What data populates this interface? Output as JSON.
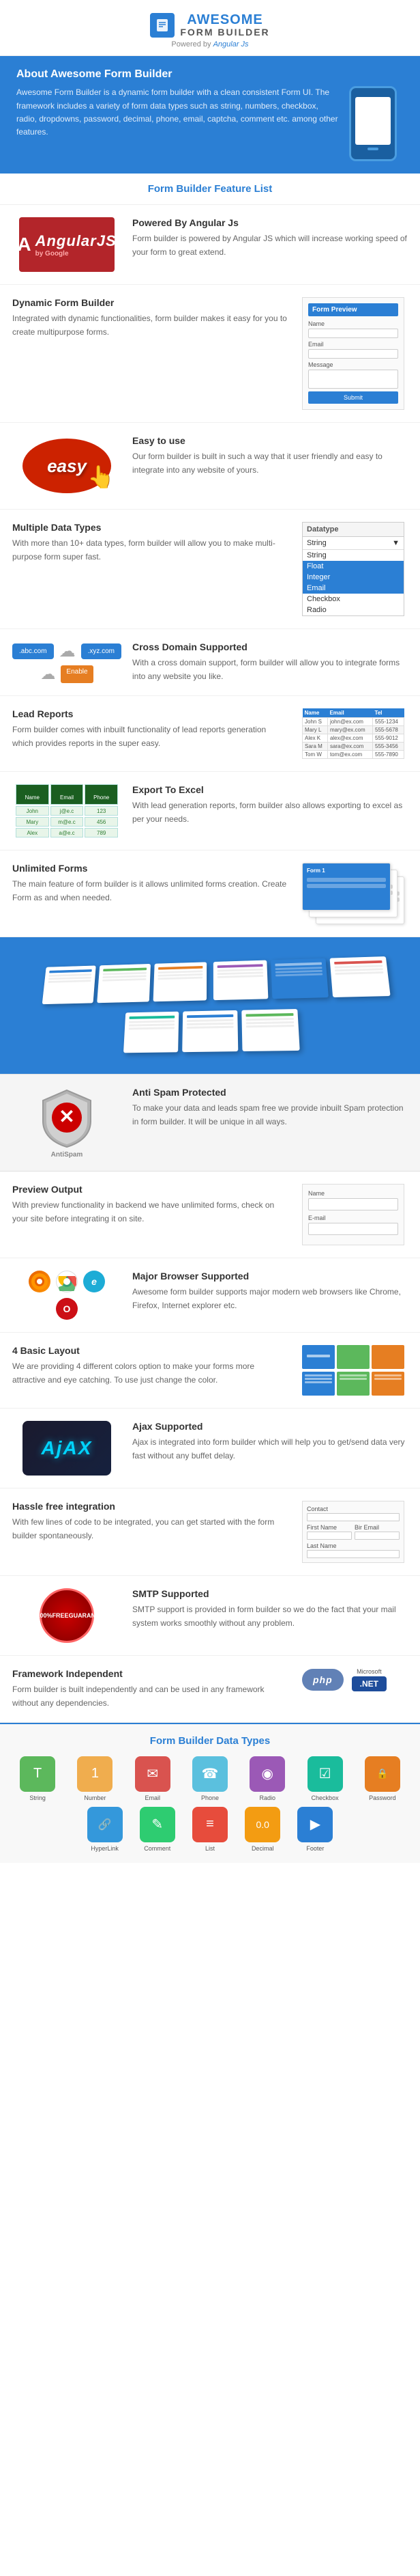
{
  "header": {
    "logo_icon": "📋",
    "logo_awesome": "AWESOME",
    "logo_formbuilder": "FORM BUILDER",
    "powered_by": "Powered by Angular Js"
  },
  "about": {
    "title": "About Awesome Form Builder",
    "description": "Awesome Form Builder is a dynamic form builder with a clean consistent Form UI. The framework includes a variety of form data types such as string, numbers, checkbox, radio, dropdowns, password, decimal, phone, email, captcha, comment etc. among other features."
  },
  "feature_list_title": "Form Builder Feature List",
  "features": [
    {
      "id": "angular",
      "title": "Powered By Angular Js",
      "description": "Form builder is powered by Angular JS which will increase working speed of your form to great extend.",
      "position": "left"
    },
    {
      "id": "dynamic",
      "title": "Dynamic Form Builder",
      "description": "Integrated with dynamic functionalities, form builder makes it easy for you to create multipurpose forms.",
      "position": "right"
    },
    {
      "id": "easy",
      "title": "Easy to use",
      "description": "Our form builder is built in such a way that it user friendly and easy to integrate into any website of yours.",
      "position": "left"
    },
    {
      "id": "datatypes",
      "title": "Multiple Data Types",
      "description": "With more than 10+ data types, form builder will allow you to make multi-purpose form super fast.",
      "position": "right",
      "dropdown_label": "Datatype",
      "dropdown_selected": "String",
      "dropdown_items": [
        "String",
        "Float",
        "Integer",
        "Email",
        "Checkbox",
        "Radio"
      ]
    },
    {
      "id": "crossdomain",
      "title": "Cross Domain Supported",
      "description": "With a cross domain support, form builder will allow you to integrate forms into any website you like.",
      "position": "left"
    },
    {
      "id": "leadreports",
      "title": "Lead Reports",
      "description": "Form builder comes with inbuilt functionality of lead reports generation which provides reports in the super easy.",
      "position": "right"
    },
    {
      "id": "export",
      "title": "Export To Excel",
      "description": "With lead generation reports, form builder also allows exporting to excel as per your needs.",
      "position": "left"
    },
    {
      "id": "unlimited",
      "title": "Unlimited Forms",
      "description": "The main feature of form builder is it allows unlimited forms creation. Create Form as and when needed.",
      "position": "right"
    }
  ],
  "antispam": {
    "title": "Anti Spam Protected",
    "description": "To make your data and leads spam free we provide inbuilt Spam protection in form builder. It will be unique in all ways."
  },
  "preview": {
    "title": "Preview Output",
    "description": "With preview functionality in backend we have unlimited forms, check on your site before integrating it on site.",
    "field1_label": "Name",
    "field2_label": "E-mail"
  },
  "browser": {
    "title": "Major Browser Supported",
    "description": "Awesome form builder supports major modern web browsers like Chrome, Firefox, Internet explorer etc."
  },
  "layout": {
    "title": "4 Basic Layout",
    "description": "We are providing 4 different colors option to make your forms more attractive and eye catching. To use just change the color.",
    "colors": [
      "#2b7fd4",
      "#5cb85c",
      "#e67e22",
      "#9b59b6",
      "#d9534f",
      "#1abc9c"
    ]
  },
  "ajax": {
    "title": "Ajax Supported",
    "description": "Ajax is integrated into form builder which will help you to get/send data very fast without any buffet delay."
  },
  "hassle": {
    "title": "Hassle free integration",
    "description": "With few lines of code to be integrated, you can get started with the form builder spontaneously.",
    "smtp_fields": [
      {
        "label": "Contact",
        "value": ""
      },
      {
        "label": "First Name",
        "value": ""
      },
      {
        "label": "Bir Email",
        "value": ""
      },
      {
        "label": "Last Name",
        "value": ""
      }
    ]
  },
  "smtp": {
    "title": "SMTP Supported",
    "description": "SMTP support is provided in form builder so we do the fact that your mail system works smoothly without any problem."
  },
  "framework": {
    "title": "Framework Independent",
    "description": "Form builder is built independently and can be used in any framework without any dependencies."
  },
  "datatypes_footer": {
    "title": "Form Builder Data Types",
    "items": [
      {
        "id": "string",
        "label": "String",
        "color": "dt-string",
        "icon": "T"
      },
      {
        "id": "number",
        "label": "Number",
        "color": "dt-number",
        "icon": "#"
      },
      {
        "id": "email",
        "label": "Email",
        "color": "dt-email",
        "icon": "✉"
      },
      {
        "id": "phone",
        "label": "Phone",
        "color": "dt-phone",
        "icon": "☎"
      },
      {
        "id": "radio",
        "label": "Radio",
        "color": "dt-radio",
        "icon": "◉"
      },
      {
        "id": "checkbox",
        "label": "Checkbox",
        "color": "dt-checkbox",
        "icon": "☑"
      },
      {
        "id": "password",
        "label": "Password",
        "color": "dt-password",
        "icon": "🔒"
      },
      {
        "id": "hyperlink",
        "label": "HyperLink",
        "color": "dt-hyperlink",
        "icon": "🔗"
      },
      {
        "id": "comment",
        "label": "Comment",
        "color": "dt-comment",
        "icon": "✎"
      },
      {
        "id": "list",
        "label": "List",
        "color": "dt-list",
        "icon": "≡"
      },
      {
        "id": "decimal",
        "label": "Decimal",
        "color": "dt-decimal",
        "icon": ".0"
      },
      {
        "id": "footer",
        "label": "Footer",
        "color": "dt-footer-icon",
        "icon": "▶"
      }
    ]
  }
}
